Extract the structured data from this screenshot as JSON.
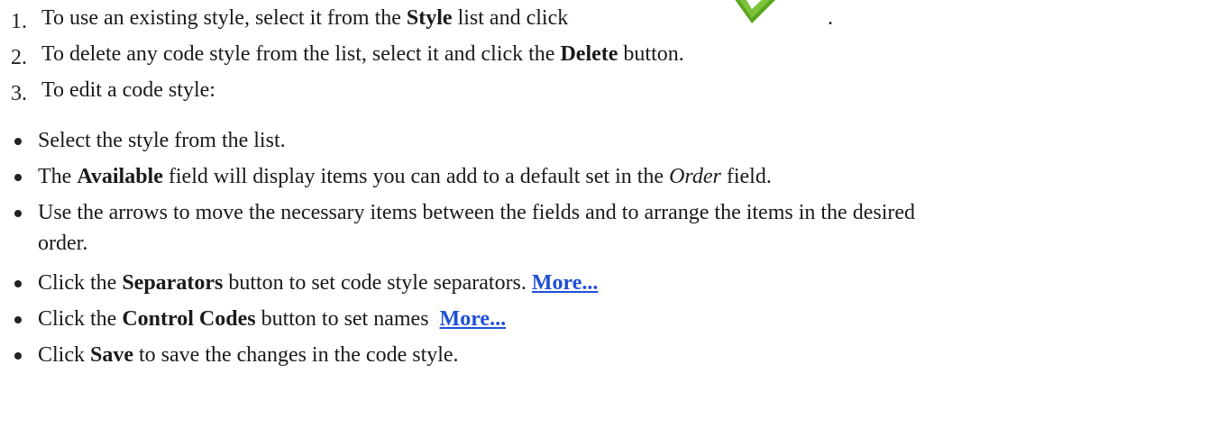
{
  "steps": [
    {
      "number": "1.",
      "text_a": "To use an existing style, select it from the ",
      "bold": "Style",
      "text_b": " list and click",
      "after_icon": "."
    },
    {
      "number": "2.",
      "text_a": "To delete any code style from the list, select it and click the ",
      "bold": "Delete",
      "text_b": " button."
    },
    {
      "number": "3.",
      "text_a": "To edit a code style:"
    }
  ],
  "bullets": [
    {
      "text": "Select the style from the list."
    },
    {
      "text_a": "The ",
      "bold": "Available",
      "text_b": " field will display items you can add to a default set in the ",
      "italic": "Order",
      "text_c": " field."
    },
    {
      "line1": "Use the arrows to move the necessary items between the fields and to arrange the items in the desired",
      "line2": "order."
    },
    {
      "text_a": "Click the ",
      "bold": "Separators",
      "text_b": " button to set code style separators. ",
      "link": "More..."
    },
    {
      "text_a": "Click the ",
      "bold": "Control Codes",
      "text_b": " button to set names ",
      "link": "More..."
    },
    {
      "text_a": "Click ",
      "bold": "Save",
      "text_b": " to save the changes in the code style."
    }
  ],
  "icons": {
    "apply": "green-checkmark-icon"
  },
  "colors": {
    "link": "#1f4fd6",
    "check": "#5aa51e"
  }
}
